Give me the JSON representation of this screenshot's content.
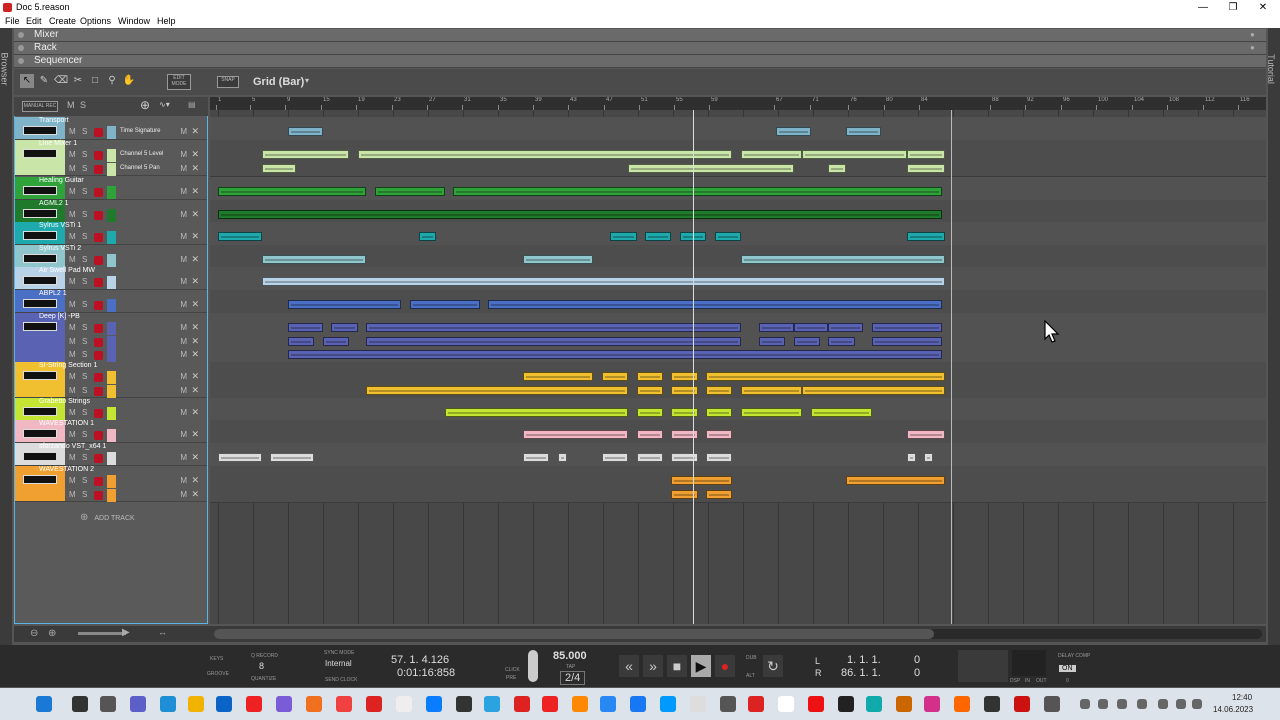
{
  "window": {
    "title": "Doc 5.reason"
  },
  "menu": [
    "File",
    "Edit",
    "Create",
    "Options",
    "Window",
    "Help"
  ],
  "side": {
    "browser": "Browser",
    "tutorial": "Tutorial"
  },
  "sections": {
    "mixer": "Mixer",
    "rack": "Rack",
    "sequencer": "Sequencer"
  },
  "toolbar": {
    "edit_mode": "EDIT MODE",
    "snap": "SNAP",
    "grid": "Grid (Bar)"
  },
  "tracklist": {
    "manual_rec": "MANUAL REC",
    "add_track": "ADD TRACK"
  },
  "tracks": [
    {
      "name": "Transport",
      "color": "#7fb3c8",
      "lanes": [
        "Time Signature"
      ]
    },
    {
      "name": "Line Mixer 1",
      "color": "#c9e5a8",
      "lanes": [
        "Channel 5 Level",
        "Channel 5 Pan"
      ]
    },
    {
      "name": "Healing Guitar",
      "color": "#2fa33a",
      "lanes": [
        ""
      ]
    },
    {
      "name": "AGML2 1",
      "color": "#1f7a2c",
      "lanes": [
        ""
      ]
    },
    {
      "name": "Sylrus VSTi 1",
      "color": "#1ea9ad",
      "lanes": [
        ""
      ]
    },
    {
      "name": "Sylrus VSTi 2",
      "color": "#8fc6cc",
      "lanes": [
        ""
      ]
    },
    {
      "name": "Air Swell Pad MW",
      "color": "#b8d3e8",
      "lanes": [
        ""
      ]
    },
    {
      "name": "ABPL2 1",
      "color": "#4b6fc4",
      "lanes": [
        ""
      ]
    },
    {
      "name": "Deep [K] -PB",
      "color": "#5a63b3",
      "lanes": [
        "",
        "",
        ""
      ]
    },
    {
      "name": "SI-String Section 1",
      "color": "#f0c030",
      "lanes": [
        "",
        ""
      ]
    },
    {
      "name": "Grabetto Strings",
      "color": "#c4e632",
      "lanes": [
        ""
      ]
    },
    {
      "name": "WAVESTATION 1",
      "color": "#f1b7c3",
      "lanes": [
        ""
      ]
    },
    {
      "name": "sforzando VST_x64 1",
      "color": "#dcdcdc",
      "lanes": [
        ""
      ]
    },
    {
      "name": "WAVESTATION 2",
      "color": "#f0a030",
      "lanes": [
        "",
        ""
      ]
    }
  ],
  "ruler": [
    "1",
    "5",
    "9",
    "15",
    "19",
    "23",
    "27",
    "31",
    "35",
    "39",
    "43",
    "47",
    "51",
    "55",
    "59",
    "67",
    "71",
    "76",
    "80",
    "84",
    "88",
    "92",
    "96",
    "100",
    "104",
    "108",
    "112",
    "116",
    "120"
  ],
  "transport": {
    "keys": "KEYS",
    "groove": "GROOVE",
    "q_record": "Q RECORD",
    "quantize": "QUANTIZE",
    "quant_value": "8",
    "sync_mode": "SYNC MODE",
    "sync_value": "Internal",
    "send_clock": "SEND CLOCK",
    "position": "57. 1. 4.126",
    "time": "0:01:16:858",
    "click": "CLICK",
    "pre": "PRE",
    "tempo": "85.000",
    "tap": "TAP",
    "signature": "2/4",
    "dub": "DUB",
    "alt": "ALT",
    "loop_l_label": "L",
    "loop_r_label": "R",
    "loop_l": "1. 1. 1.",
    "loop_l_tick": "0",
    "loop_r": "86. 1. 1.",
    "loop_r_tick": "0",
    "dsp": "DSP",
    "in": "IN",
    "out": "OUT",
    "delay_comp": "DELAY COMP",
    "delay_on": "ON",
    "delay_val": "0"
  },
  "taskbar": {
    "time": "12:40",
    "date": "14.06.2023"
  }
}
